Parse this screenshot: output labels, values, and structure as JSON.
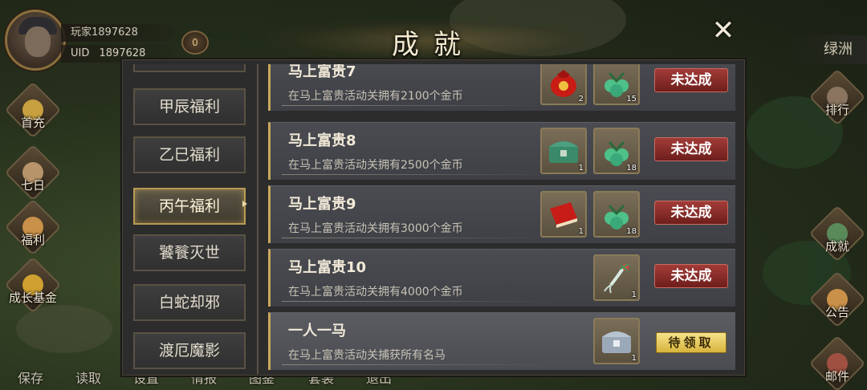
{
  "player": {
    "name": "玩家1897628",
    "uid_label": "UID",
    "uid_value": "1897628",
    "vip": "0"
  },
  "location": "绿洲",
  "left_menu": [
    {
      "label": "首充",
      "icon": "first-charge-icon",
      "color": "#c8a040"
    },
    {
      "label": "七日",
      "icon": "scroll-icon",
      "color": "#b8946a"
    },
    {
      "label": "福利",
      "icon": "gift-icon",
      "color": "#c89048"
    },
    {
      "label": "成长基金",
      "icon": "treasure-icon",
      "color": "#d0a030"
    }
  ],
  "right_menu": [
    {
      "label": "排行",
      "icon": "ranking-icon"
    },
    {
      "label": "成就",
      "icon": "achievement-icon"
    },
    {
      "label": "公告",
      "icon": "notice-icon"
    },
    {
      "label": "邮件",
      "icon": "mail-icon"
    }
  ],
  "bottom_bar": [
    "保存",
    "读取",
    "设置",
    "情报",
    "图鉴",
    "套装",
    "退出"
  ],
  "dialog": {
    "title": "成就",
    "close": "✕",
    "categories": [
      {
        "label": "甲辰福利",
        "active": false
      },
      {
        "label": "乙巳福利",
        "active": false
      },
      {
        "label": "丙午福利",
        "active": true
      },
      {
        "label": "饕餮灭世",
        "active": false
      },
      {
        "label": "白蛇却邪",
        "active": false
      },
      {
        "label": "渡厄魔影",
        "active": false
      }
    ],
    "achievements": [
      {
        "title": "马上富贵7",
        "desc": "在马上富贵活动关拥有2100个金币",
        "rewards": [
          {
            "icon": "red-pouch-icon",
            "count": "2"
          },
          {
            "icon": "jade-gem-icon",
            "count": "15"
          }
        ],
        "status": "未达成",
        "claimable": false
      },
      {
        "title": "马上富贵8",
        "desc": "在马上富贵活动关拥有2500个金币",
        "rewards": [
          {
            "icon": "jade-chest-icon",
            "count": "1"
          },
          {
            "icon": "jade-gem-icon",
            "count": "18"
          }
        ],
        "status": "未达成",
        "claimable": false
      },
      {
        "title": "马上富贵9",
        "desc": "在马上富贵活动关拥有3000个金币",
        "rewards": [
          {
            "icon": "red-book-icon",
            "count": "1"
          },
          {
            "icon": "jade-gem-icon",
            "count": "18"
          }
        ],
        "status": "未达成",
        "claimable": false
      },
      {
        "title": "马上富贵10",
        "desc": "在马上富贵活动关拥有4000个金币",
        "rewards": [
          {
            "icon": "spirit-root-icon",
            "count": "1"
          }
        ],
        "status": "未达成",
        "claimable": false
      },
      {
        "title": "一人一马",
        "desc": "在马上富贵活动关捕获所有名马",
        "rewards": [
          {
            "icon": "silver-chest-icon",
            "count": "1"
          }
        ],
        "status": "待领取",
        "claimable": true
      }
    ]
  }
}
